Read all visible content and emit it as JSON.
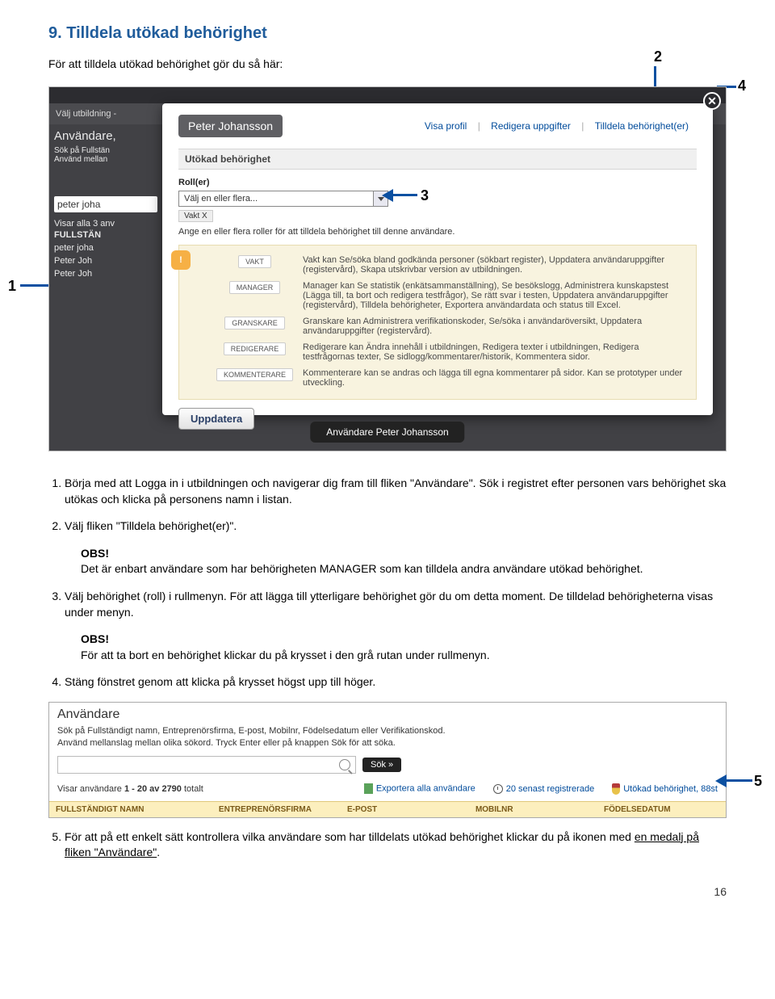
{
  "heading": "9. Tilldela utökad behörighet",
  "intro": "För att tilldela utökad behörighet gör du så här:",
  "callouts": {
    "c1": "1",
    "c2": "2",
    "c3": "3",
    "c4": "4",
    "c5": "5"
  },
  "shot1": {
    "nav_item": "Välj utbildning  -",
    "side": {
      "title": "Användare,",
      "l1": "Sök på Fullstän",
      "l2": "Använd mellan",
      "search": "peter joha",
      "result_hdr": "Visar alla 3 anv",
      "r_full": "FULLSTÄN",
      "r1": "peter joha",
      "r2": "Peter Joh",
      "r3": "Peter Joh"
    },
    "modal": {
      "name": "Peter Johansson",
      "link1": "Visa profil",
      "link2": "Redigera uppgifter",
      "link3": "Tilldela behörighet(er)",
      "sep": "|",
      "subhead": "Utökad behörighet",
      "roller_label": "Roll(er)",
      "select_placeholder": "Välj en eller flera...",
      "chip": "Vakt  X",
      "hint": "Ange en eller flera roller för att tilldela behörighet till denne användare.",
      "roles": [
        {
          "name": "VAKT",
          "desc": "Vakt kan Se/söka bland godkända personer (sökbart register), Uppdatera användaruppgifter (registervård), Skapa utskrivbar version av utbildningen."
        },
        {
          "name": "MANAGER",
          "desc": "Manager kan Se statistik (enkätsammanställning), Se besökslogg, Administrera kunskapstest (Lägga till, ta bort och redigera testfrågor), Se rätt svar i testen, Uppdatera användaruppgifter (registervård), Tilldela behörigheter, Exportera användardata och status till Excel."
        },
        {
          "name": "GRANSKARE",
          "desc": "Granskare kan Administrera verifikationskoder, Se/söka i användaröversikt, Uppdatera användaruppgifter (registervård)."
        },
        {
          "name": "REDIGERARE",
          "desc": "Redigerare kan Ändra innehåll i utbildningen, Redigera texter i utbildningen, Redigera testfrågornas texter, Se sidlogg/kommentarer/historik, Kommentera sidor."
        },
        {
          "name": "KOMMENTERARE",
          "desc": "Kommenterare kan se andras och lägga till egna kommentarer på sidor. Kan se prototyper under utveckling."
        }
      ],
      "update_btn": "Uppdatera"
    },
    "footer_pill": "Användare Peter Johansson",
    "close": "✕"
  },
  "steps": {
    "s1a": "Börja med att Logga in i utbildningen och navigerar dig fram till fliken \"Användare\". Sök i registret efter personen vars behörighet ska utökas och klicka på personens namn i listan.",
    "s2": "Välj fliken \"Tilldela behörighet(er)\".",
    "obs_title": "OBS!",
    "obs1": "Det är enbart användare som har behörigheten MANAGER som kan tilldela andra användare utökad behörighet.",
    "s3": "Välj behörighet (roll) i rullmenyn. För att lägga till ytterligare behörighet gör du om detta moment. De tilldelad behörigheterna  visas under menyn.",
    "obs2": "För att ta bort en behörighet klickar du på krysset i den grå rutan under rullmenyn.",
    "s4": "Stäng fönstret genom att klicka på krysset högst upp till höger.",
    "s5a": "För att på ett enkelt sätt kontrollera vilka användare som har tilldelats utökad behörighet klickar du på ikonen med ",
    "s5b": "en medalj på fliken \"Användare\"",
    "s5c": "."
  },
  "shot2": {
    "head": "Användare",
    "sub1": "Sök på Fullständigt namn, Entreprenörsfirma, E-post, Mobilnr, Födelsedatum eller Verifikationskod.",
    "sub2": "Använd mellanslag mellan olika sökord. Tryck Enter eller på knappen Sök för att söka.",
    "sok": "Sök »",
    "count_a": "Visar användare ",
    "count_b": "1 - 20 av 2790",
    "count_c": " totalt",
    "export": "Exportera alla användare",
    "recent": "20 senast registrerade",
    "medal": "Utökad behörighet, 88st",
    "cols": [
      "FULLSTÄNDIGT NAMN",
      "ENTREPRENÖRSFIRMA",
      "E-POST",
      "MOBILNR",
      "FÖDELSEDATUM"
    ]
  },
  "page_number": "16"
}
